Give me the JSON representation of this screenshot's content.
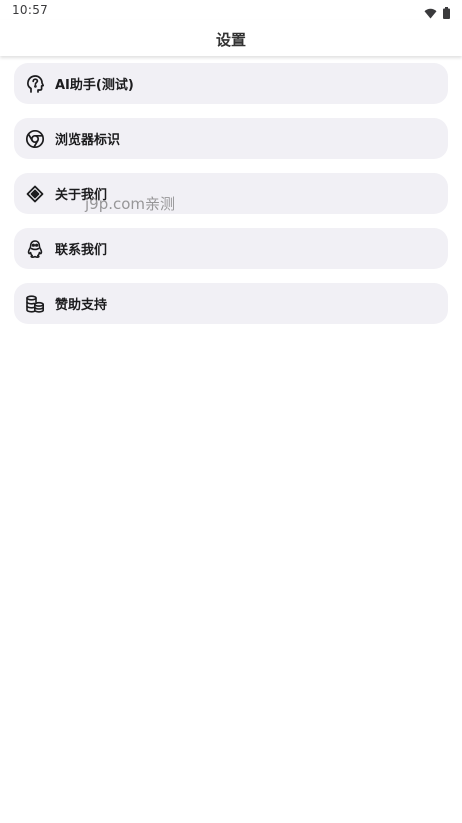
{
  "status_bar": {
    "time": "10:57",
    "icons": [
      "wifi-icon",
      "battery-icon"
    ]
  },
  "app_bar": {
    "title": "设置"
  },
  "menu": {
    "items": [
      {
        "label": "AI助手(测试)",
        "icon": "ai-head-icon"
      },
      {
        "label": "浏览器标识",
        "icon": "chrome-icon"
      },
      {
        "label": "关于我们",
        "icon": "diamond-icon"
      },
      {
        "label": "联系我们",
        "icon": "qq-penguin-icon"
      },
      {
        "label": "赞助支持",
        "icon": "coins-icon"
      }
    ]
  },
  "watermark": {
    "text": "j9p.com亲测"
  },
  "colors": {
    "row_background": "#f1f0f5",
    "text": "#1c1c1e",
    "title": "#333333"
  }
}
